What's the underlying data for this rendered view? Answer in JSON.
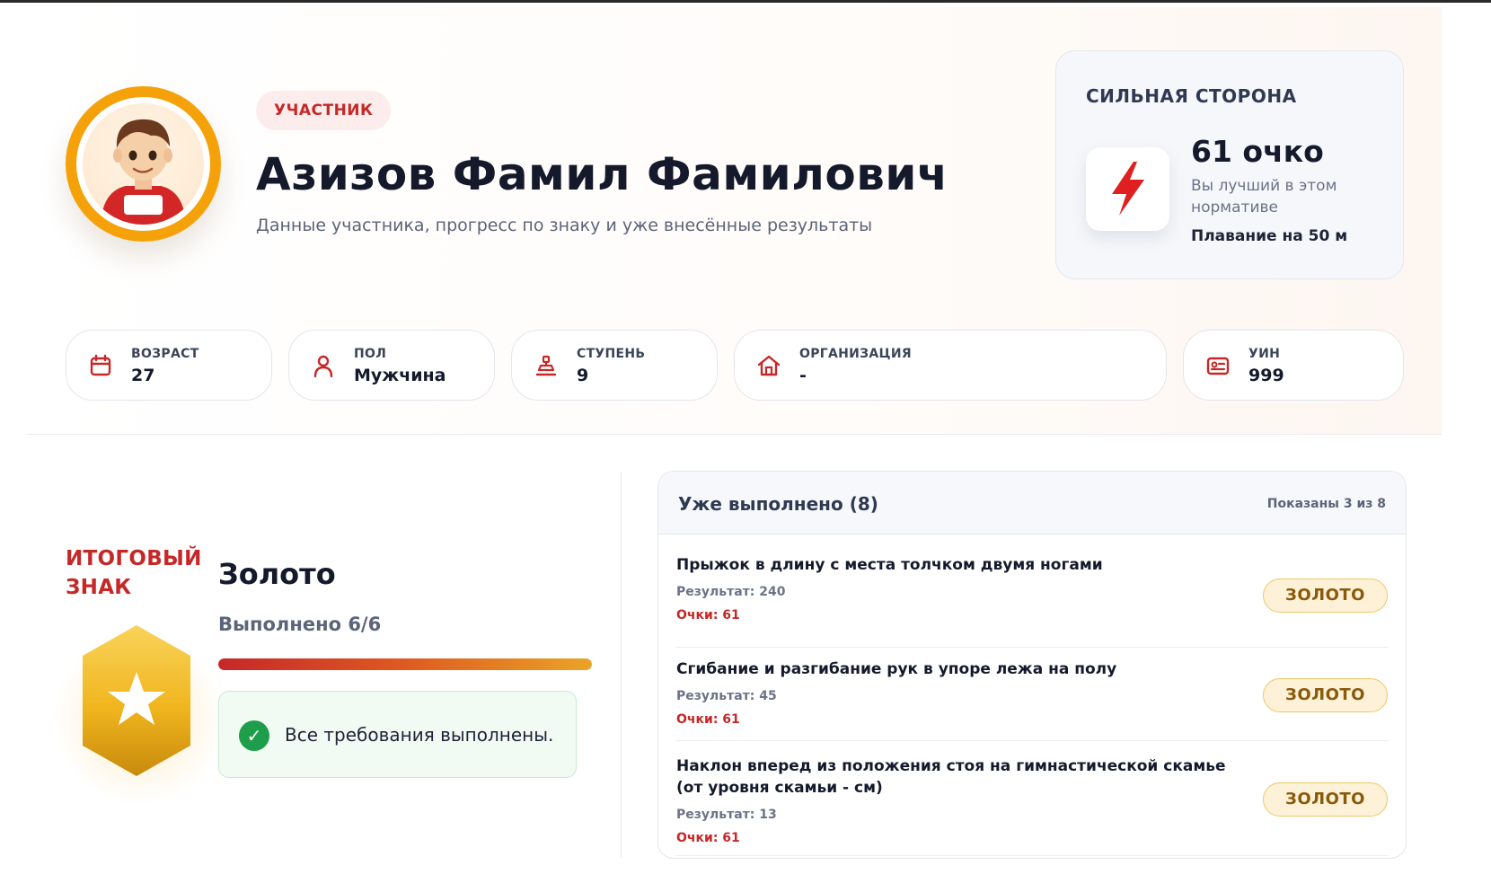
{
  "profile": {
    "role": "УЧАСТНИК",
    "name": "Азизов Фамил Фамилович",
    "subtitle": "Данные участника, прогресс по знаку и уже внесённые результаты"
  },
  "strength": {
    "title": "СИЛЬНАЯ СТОРОНА",
    "points": "61 очко",
    "description": "Вы лучший в этом нормативе",
    "event": "Плавание на 50 м",
    "icon": "lightning-icon"
  },
  "info": [
    {
      "label": "ВОЗРАСТ",
      "value": "27",
      "icon": "calendar-icon"
    },
    {
      "label": "ПОЛ",
      "value": "Мужчина",
      "icon": "person-icon"
    },
    {
      "label": "СТУПЕНЬ",
      "value": "9",
      "icon": "podium-icon"
    },
    {
      "label": "ОРГАНИЗАЦИЯ",
      "value": "-",
      "icon": "home-icon"
    },
    {
      "label": "УИН",
      "value": "999",
      "icon": "id-card-icon"
    }
  ],
  "summary": {
    "final_label": "ИТОГОВЫЙ ЗНАК",
    "award": "Золото",
    "progress_text": "Выполнено 6/6",
    "progress_fraction": 1.0,
    "requirements": "Все требования выполнены."
  },
  "completed": {
    "title": "Уже выполнено (8)",
    "shown": "Показаны 3 из 8",
    "items": [
      {
        "name": "Прыжок в длину с места толчком двумя ногами",
        "result": "Результат: 240",
        "points": "Очки: 61",
        "badge": "ЗОЛОТО"
      },
      {
        "name": "Сгибание и разгибание рук в упоре лежа на полу",
        "result": "Результат: 45",
        "points": "Очки: 61",
        "badge": "ЗОЛОТО"
      },
      {
        "name": "Наклон вперед из положения стоя на гимнастической скамье (от уровня скамьи - см)",
        "result": "Результат: 13",
        "points": "Очки: 61",
        "badge": "ЗОЛОТО"
      }
    ]
  },
  "colors": {
    "accent_red": "#c62828",
    "gold": "#f5a20a",
    "success": "#1e9e4a"
  }
}
